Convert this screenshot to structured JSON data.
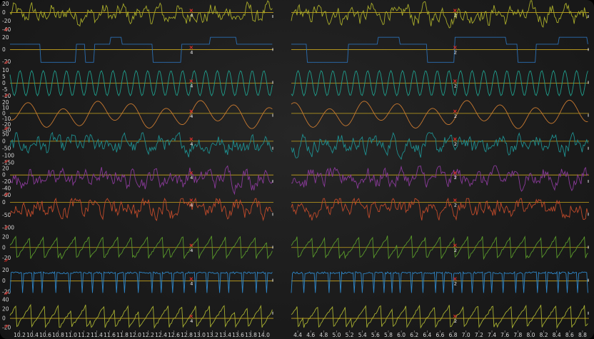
{
  "chart_data": {
    "type": "line",
    "panels": [
      {
        "name": "left",
        "x_ticks": [
          "10.2",
          "10.4",
          "10.6",
          "10.8",
          "11.0",
          "11.2",
          "11.4",
          "11.6",
          "11.8",
          "12.0",
          "12.2",
          "12.4",
          "12.6",
          "12.8",
          "13.0",
          "13.2",
          "13.4",
          "13.6",
          "13.8",
          "14.0"
        ],
        "x_range": [
          10.05,
          14.15
        ],
        "marker_label": "4",
        "marker_x": 12.87
      },
      {
        "name": "right",
        "x_ticks": [
          "4.4",
          "4.6",
          "4.8",
          "5.0",
          "5.2",
          "5.4",
          "5.6",
          "5.8",
          "6.0",
          "6.2",
          "6.4",
          "6.6",
          "6.8",
          "7.0",
          "7.2",
          "7.4",
          "7.6",
          "7.8",
          "8.0",
          "8.2",
          "8.4",
          "8.6",
          "8.8"
        ],
        "x_range": [
          4.3,
          8.9
        ],
        "marker_label": "2",
        "marker_x": 6.83
      }
    ],
    "series": [
      {
        "color": "#a8ab2a",
        "y_ticks": [
          "20",
          "0",
          "-20",
          "-40"
        ],
        "ylim": [
          -50,
          28
        ],
        "pattern": "noise"
      },
      {
        "color": "#2b6fb3",
        "y_ticks": [
          "20",
          "0",
          "-20"
        ],
        "ylim": [
          -28,
          26
        ],
        "pattern": "square"
      },
      {
        "color": "#1f9e8c",
        "y_ticks": [
          "10",
          "5",
          "0",
          "-5",
          "-10"
        ],
        "ylim": [
          -13,
          13
        ],
        "pattern": "sine"
      },
      {
        "color": "#c97a30",
        "y_ticks": [
          "20",
          "10",
          "0",
          "-10",
          "-20",
          "-30"
        ],
        "ylim": [
          -35,
          25
        ],
        "pattern": "wave"
      },
      {
        "color": "#1e8f8f",
        "y_ticks": [
          "50",
          "0",
          "-50",
          "-100",
          "-150"
        ],
        "ylim": [
          -170,
          60
        ],
        "pattern": "noise"
      },
      {
        "color": "#8a3a9a",
        "y_ticks": [
          "20",
          "0",
          "-20",
          "-40",
          "-60"
        ],
        "ylim": [
          -70,
          28
        ],
        "pattern": "noise"
      },
      {
        "color": "#c04a2a",
        "y_ticks": [
          "0",
          "-50",
          "-100"
        ],
        "ylim": [
          -115,
          15
        ],
        "pattern": "noise"
      },
      {
        "color": "#5a9a2a",
        "y_ticks": [
          "20",
          "0",
          "-20"
        ],
        "ylim": [
          -32,
          30
        ],
        "pattern": "saw"
      },
      {
        "color": "#2e86c8",
        "y_ticks": [
          "20",
          "0",
          "-20"
        ],
        "ylim": [
          -30,
          30
        ],
        "pattern": "pulse"
      },
      {
        "color": "#a8b030",
        "y_ticks": [
          "40",
          "20",
          "0",
          "-20"
        ],
        "ylim": [
          -26,
          45
        ],
        "pattern": "saw"
      }
    ],
    "baseline_color": "#c8a51e",
    "marker_color": "#e0302a",
    "grid": false
  }
}
